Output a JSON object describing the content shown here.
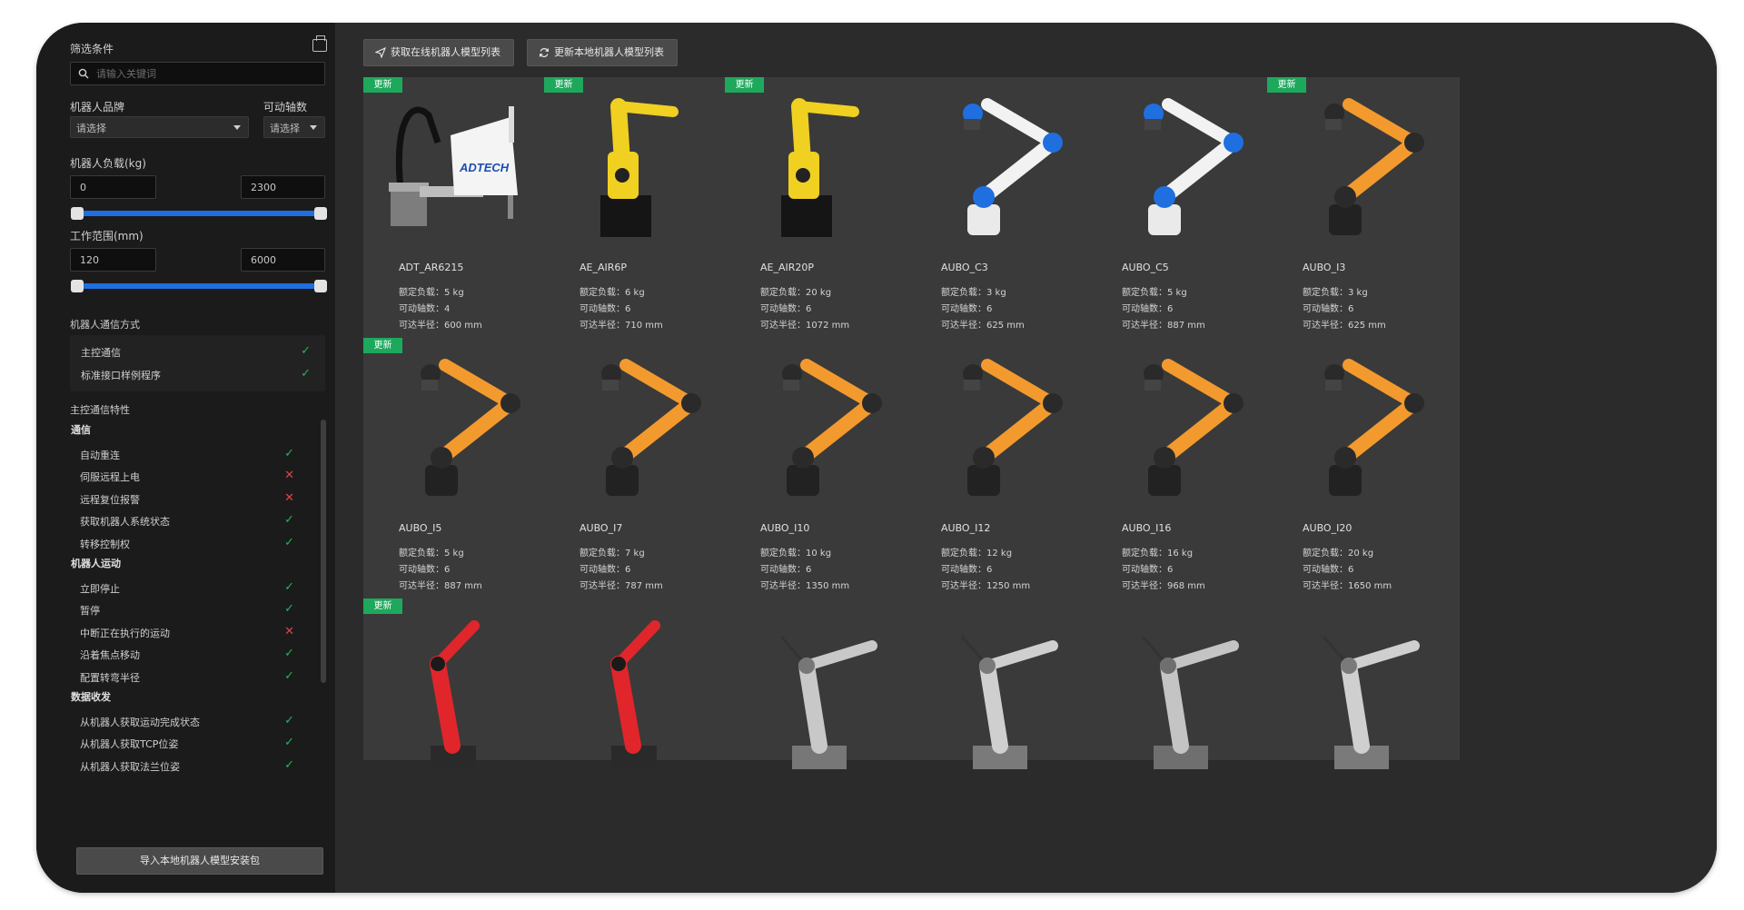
{
  "sidebar": {
    "title": "筛选条件",
    "search_placeholder": "请输入关键词",
    "brand_label": "机器人品牌",
    "axes_label": "可动轴数",
    "brand_select": "请选择",
    "axes_select": "请选择",
    "payload_label": "机器人负载(kg)",
    "payload_min": "0",
    "payload_max": "2300",
    "range_label": "工作范围(mm)",
    "range_min": "120",
    "range_max": "6000",
    "comm_label": "机器人通信方式",
    "comm_items": [
      {
        "label": "主控通信",
        "ok": true
      },
      {
        "label": "标准接口样例程序",
        "ok": true
      }
    ],
    "features_label": "主控通信特性",
    "groups": [
      {
        "title": "通信",
        "items": [
          {
            "label": "自动重连",
            "ok": true
          },
          {
            "label": "伺服远程上电",
            "ok": false
          },
          {
            "label": "远程复位报警",
            "ok": false
          },
          {
            "label": "获取机器人系统状态",
            "ok": true
          },
          {
            "label": "转移控制权",
            "ok": true
          }
        ]
      },
      {
        "title": "机器人运动",
        "items": [
          {
            "label": "立即停止",
            "ok": true
          },
          {
            "label": "暂停",
            "ok": true
          },
          {
            "label": "中断正在执行的运动",
            "ok": false
          },
          {
            "label": "沿着焦点移动",
            "ok": true
          },
          {
            "label": "配置转弯半径",
            "ok": true
          }
        ]
      },
      {
        "title": "数据收发",
        "items": [
          {
            "label": "从机器人获取运动完成状态",
            "ok": true
          },
          {
            "label": "从机器人获取TCP位姿",
            "ok": true
          },
          {
            "label": "从机器人获取法兰位姿",
            "ok": true
          }
        ]
      }
    ],
    "import_button": "导入本地机器人模型安装包",
    "check_glyph": "✓",
    "cross_glyph": "✕"
  },
  "toolbar": {
    "fetch_online": "获取在线机器人模型列表",
    "refresh_local": "更新本地机器人模型列表"
  },
  "spec_labels": {
    "payload": "额定负载：",
    "axes": "可动轴数：",
    "reach": "可达半径："
  },
  "update_badge": "更新",
  "logo_text": "ADTECH",
  "cards": [
    {
      "name": "ADT_AR6215",
      "payload": "5 kg",
      "axes": "4",
      "reach": "600 mm",
      "badge": true,
      "art": "scara"
    },
    {
      "name": "AE_AIR6P",
      "payload": "6 kg",
      "axes": "6",
      "reach": "710 mm",
      "badge": true,
      "art": "yellow"
    },
    {
      "name": "AE_AIR20P",
      "payload": "20 kg",
      "axes": "6",
      "reach": "1072 mm",
      "badge": true,
      "art": "yellow2"
    },
    {
      "name": "AUBO_C3",
      "payload": "3 kg",
      "axes": "6",
      "reach": "625 mm",
      "badge": false,
      "art": "white"
    },
    {
      "name": "AUBO_C5",
      "payload": "5 kg",
      "axes": "6",
      "reach": "887 mm",
      "badge": false,
      "art": "white"
    },
    {
      "name": "AUBO_I3",
      "payload": "3 kg",
      "axes": "6",
      "reach": "625 mm",
      "badge": true,
      "art": "orange"
    },
    {
      "name": "AUBO_I5",
      "payload": "5 kg",
      "axes": "6",
      "reach": "887 mm",
      "badge": true,
      "art": "orange"
    },
    {
      "name": "AUBO_I7",
      "payload": "7 kg",
      "axes": "6",
      "reach": "787 mm",
      "badge": false,
      "art": "orange"
    },
    {
      "name": "AUBO_I10",
      "payload": "10 kg",
      "axes": "6",
      "reach": "1350 mm",
      "badge": false,
      "art": "orange2"
    },
    {
      "name": "AUBO_I12",
      "payload": "12 kg",
      "axes": "6",
      "reach": "1250 mm",
      "badge": false,
      "art": "orange2"
    },
    {
      "name": "AUBO_I16",
      "payload": "16 kg",
      "axes": "6",
      "reach": "968 mm",
      "badge": false,
      "art": "orange"
    },
    {
      "name": "AUBO_I20",
      "payload": "20 kg",
      "axes": "6",
      "reach": "1650 mm",
      "badge": false,
      "art": "orange2"
    },
    {
      "name": "",
      "badge": true,
      "art": "red"
    },
    {
      "name": "",
      "badge": false,
      "art": "red"
    },
    {
      "name": "",
      "badge": false,
      "art": "silver"
    },
    {
      "name": "",
      "badge": false,
      "art": "silver2"
    },
    {
      "name": "",
      "badge": false,
      "art": "silver3"
    },
    {
      "name": "",
      "badge": false,
      "art": "silver2"
    }
  ]
}
